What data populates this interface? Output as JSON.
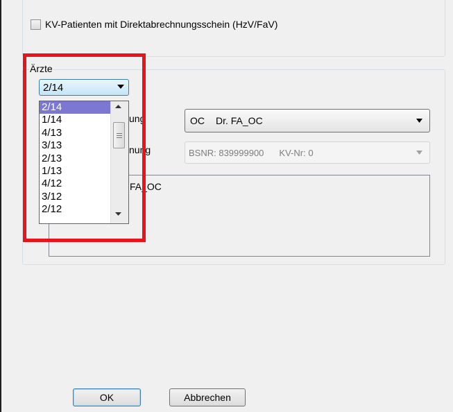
{
  "colors": {
    "highlight": "#e8141c",
    "list_selection": "#7c77d2",
    "dialog_background": "#f0f0f0"
  },
  "top_group": {
    "checkbox_label": "KV-Patienten mit Direktabrechnungsschein (HzV/FaV)",
    "checkbox_checked": false
  },
  "aerzte": {
    "legend": "Ärzte",
    "year_select": {
      "value": "2/14",
      "options": [
        "2/14",
        "1/14",
        "4/13",
        "3/13",
        "2/13",
        "1/13",
        "4/12",
        "3/12",
        "2/12"
      ]
    },
    "label_fragment_1": "ung",
    "label_fragment_2": "nung",
    "doctor_select": {
      "code": "OC",
      "name": "Dr. FA_OC"
    },
    "bsnr_select": {
      "bsnr": "BSNR: 839999900",
      "kvnr": "KV-Nr: 0"
    },
    "info_text": "FA_OC"
  },
  "buttons": {
    "ok": "OK",
    "cancel": "Abbrechen"
  },
  "icons": {
    "dropdown": "chevron-down-icon",
    "scroll_up": "scroll-up-arrow-icon",
    "scroll_down": "scroll-down-arrow-icon"
  }
}
